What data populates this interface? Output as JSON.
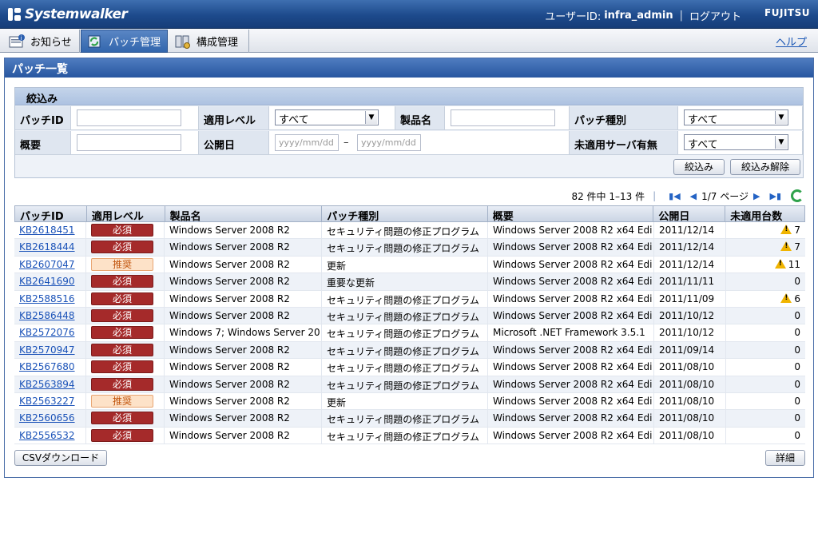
{
  "header": {
    "logo_text": "Systemwalker",
    "user_label": "ユーザーID:",
    "username": "infra_admin",
    "separator": "|",
    "logout": "ログアウト",
    "vendor": "FUJITSU"
  },
  "tabs": [
    {
      "label": "お知らせ",
      "icon": "notice-icon"
    },
    {
      "label": "パッチ管理",
      "icon": "patch-icon"
    },
    {
      "label": "構成管理",
      "icon": "config-icon"
    }
  ],
  "help_label": "ヘルプ",
  "panel_title": "パッチ一覧",
  "filter": {
    "title": "絞込み",
    "patch_id_label": "パッチID",
    "level_label": "適用レベル",
    "level_value": "すべて",
    "product_label": "製品名",
    "type_label": "パッチ種別",
    "type_value": "すべて",
    "summary_label": "概要",
    "date_label": "公開日",
    "date_from_placeholder": "yyyy/mm/dd",
    "date_to_placeholder": "yyyy/mm/dd",
    "date_separator": "–",
    "unapplied_label": "未適用サーバ有無",
    "unapplied_value": "すべて",
    "apply_button": "絞込み",
    "clear_button": "絞込み解除"
  },
  "pager": {
    "summary": "82 件中 1–13 件",
    "page": "1/7 ページ"
  },
  "table": {
    "columns": [
      "パッチID",
      "適用レベル",
      "製品名",
      "パッチ種別",
      "概要",
      "公開日",
      "未適用台数"
    ],
    "rows": [
      {
        "id": "KB2618451",
        "level": "必須",
        "product": "Windows Server 2008 R2",
        "type": "セキュリティ問題の修正プログラム",
        "summary": "Windows Server 2008 R2 x64 Edi",
        "date": "2011/12/14",
        "count": "7",
        "warn": true
      },
      {
        "id": "KB2618444",
        "level": "必須",
        "product": "Windows Server 2008 R2",
        "type": "セキュリティ問題の修正プログラム",
        "summary": "Windows Server 2008 R2 x64 Edi",
        "date": "2011/12/14",
        "count": "7",
        "warn": true
      },
      {
        "id": "KB2607047",
        "level": "推奨",
        "product": "Windows Server 2008 R2",
        "type": "更新",
        "summary": "Windows Server 2008 R2 x64 Edi",
        "date": "2011/12/14",
        "count": "11",
        "warn": true
      },
      {
        "id": "KB2641690",
        "level": "必須",
        "product": "Windows Server 2008 R2",
        "type": "重要な更新",
        "summary": "Windows Server 2008 R2 x64 Edi",
        "date": "2011/11/11",
        "count": "0",
        "warn": false
      },
      {
        "id": "KB2588516",
        "level": "必須",
        "product": "Windows Server 2008 R2",
        "type": "セキュリティ問題の修正プログラム",
        "summary": "Windows Server 2008 R2 x64 Edi",
        "date": "2011/11/09",
        "count": "6",
        "warn": true
      },
      {
        "id": "KB2586448",
        "level": "必須",
        "product": "Windows Server 2008 R2",
        "type": "セキュリティ問題の修正プログラム",
        "summary": "Windows Server 2008 R2 x64 Edi",
        "date": "2011/10/12",
        "count": "0",
        "warn": false
      },
      {
        "id": "KB2572076",
        "level": "必須",
        "product": "Windows 7; Windows Server 20",
        "type": "セキュリティ問題の修正プログラム",
        "summary": "Microsoft .NET Framework 3.5.1",
        "date": "2011/10/12",
        "count": "0",
        "warn": false
      },
      {
        "id": "KB2570947",
        "level": "必須",
        "product": "Windows Server 2008 R2",
        "type": "セキュリティ問題の修正プログラム",
        "summary": "Windows Server 2008 R2 x64 Edi",
        "date": "2011/09/14",
        "count": "0",
        "warn": false
      },
      {
        "id": "KB2567680",
        "level": "必須",
        "product": "Windows Server 2008 R2",
        "type": "セキュリティ問題の修正プログラム",
        "summary": "Windows Server 2008 R2 x64 Edi",
        "date": "2011/08/10",
        "count": "0",
        "warn": false
      },
      {
        "id": "KB2563894",
        "level": "必須",
        "product": "Windows Server 2008 R2",
        "type": "セキュリティ問題の修正プログラム",
        "summary": "Windows Server 2008 R2 x64 Edi",
        "date": "2011/08/10",
        "count": "0",
        "warn": false
      },
      {
        "id": "KB2563227",
        "level": "推奨",
        "product": "Windows Server 2008 R2",
        "type": "更新",
        "summary": "Windows Server 2008 R2 x64 Edi",
        "date": "2011/08/10",
        "count": "0",
        "warn": false
      },
      {
        "id": "KB2560656",
        "level": "必須",
        "product": "Windows Server 2008 R2",
        "type": "セキュリティ問題の修正プログラム",
        "summary": "Windows Server 2008 R2 x64 Edi",
        "date": "2011/08/10",
        "count": "0",
        "warn": false
      },
      {
        "id": "KB2556532",
        "level": "必須",
        "product": "Windows Server 2008 R2",
        "type": "セキュリティ問題の修正プログラム",
        "summary": "Windows Server 2008 R2 x64 Edi",
        "date": "2011/08/10",
        "count": "0",
        "warn": false
      }
    ]
  },
  "csv_button": "CSVダウンロード",
  "detail_button": "詳細",
  "colors": {
    "header": "#1d4a8c",
    "required": "#a52a2a",
    "recommended": "#fde2c8",
    "link": "#1a52b8",
    "warning": "#f0b400"
  }
}
